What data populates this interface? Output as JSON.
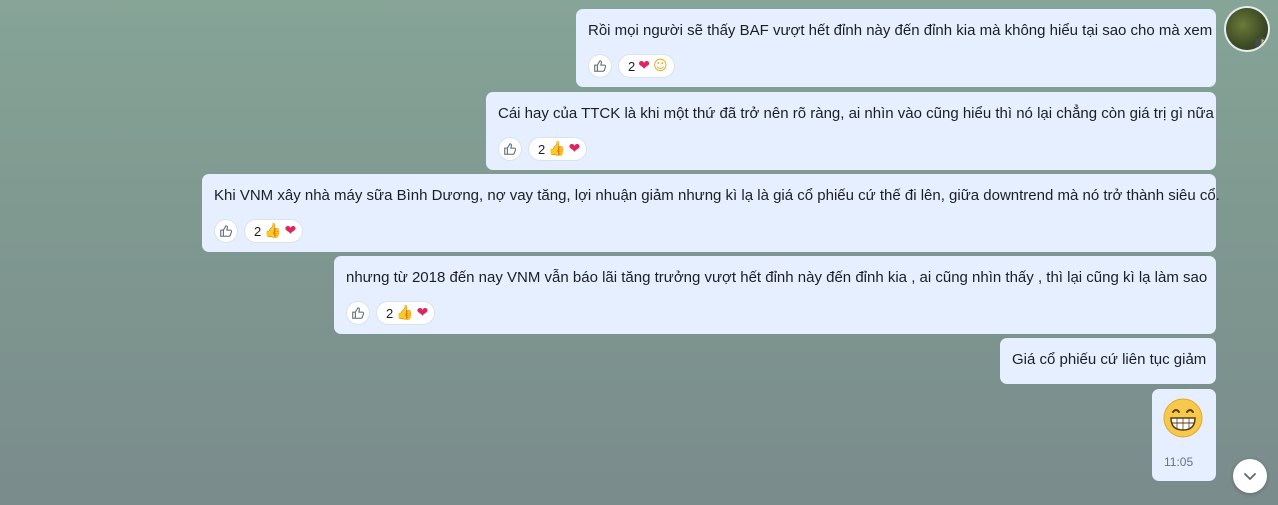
{
  "messages": [
    {
      "text": "Rồi mọi người sẽ thấy BAF vượt hết đỉnh này đến đỉnh kia mà không hiểu tại sao cho mà xem",
      "reaction_count": "2",
      "reactions": [
        "heart",
        "surprised-face"
      ]
    },
    {
      "text": "Cái hay của TTCK là khi một thứ đã trở nên rõ ràng, ai nhìn vào cũng hiểu thì nó lại chẳng còn giá trị gì nữa",
      "reaction_count": "2",
      "reactions": [
        "thumbs-up",
        "heart"
      ]
    },
    {
      "text": "Khi VNM xây nhà máy sữa Bình Dương, nợ vay tăng, lợi nhuận giảm nhưng kì lạ là giá cổ phiếu cứ thế đi lên, giữa downtrend mà nó trở thành siêu cổ.",
      "reaction_count": "2",
      "reactions": [
        "thumbs-up",
        "heart"
      ]
    },
    {
      "text": "nhưng từ 2018 đến nay VNM vẫn báo lãi tăng trưởng vượt hết đỉnh này đến đỉnh kia , ai cũng nhìn thấy  , thì lại cũng kì lạ làm sao",
      "reaction_count": "2",
      "reactions": [
        "thumbs-up",
        "heart"
      ]
    },
    {
      "text": "Giá cổ phiếu cứ liên tục giảm"
    }
  ],
  "sticker": {
    "icon": "grinning-face-icon",
    "time": "11:05"
  },
  "colors": {
    "bubble": "#e5efff",
    "heart": "#e0245e",
    "thumbs": "#e5a42a"
  }
}
